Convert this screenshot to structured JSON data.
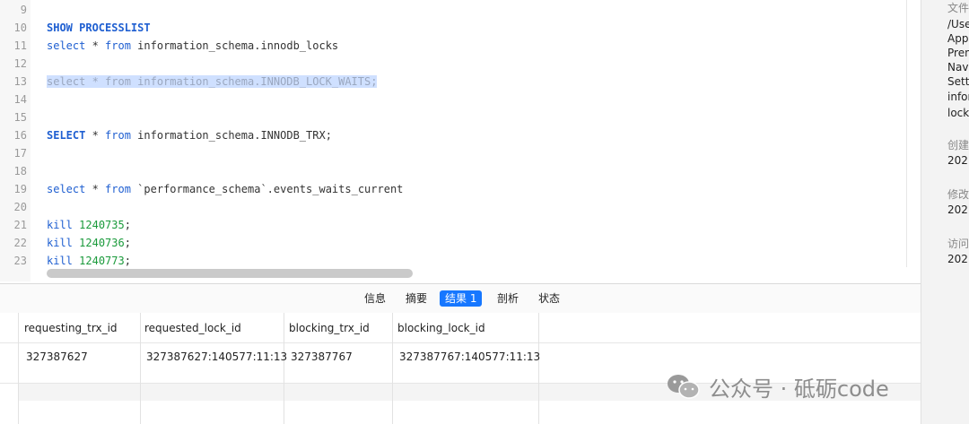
{
  "editor": {
    "lines": [
      {
        "num": "9",
        "parts": []
      },
      {
        "num": "10",
        "parts": [
          {
            "t": "SHOW PROCESSLIST",
            "c": "kw"
          }
        ]
      },
      {
        "num": "11",
        "parts": [
          {
            "t": "select",
            "c": "kw-thin"
          },
          {
            "t": " * ",
            "c": ""
          },
          {
            "t": "from",
            "c": "kw-thin"
          },
          {
            "t": " information_schema.innodb_locks",
            "c": ""
          }
        ]
      },
      {
        "num": "12",
        "parts": []
      },
      {
        "num": "13",
        "parts": [
          {
            "t": "select * from information_schema.INNODB_LOCK_WAITS;",
            "c": "sel"
          }
        ]
      },
      {
        "num": "14",
        "parts": []
      },
      {
        "num": "15",
        "parts": []
      },
      {
        "num": "16",
        "parts": [
          {
            "t": "SELECT",
            "c": "kw"
          },
          {
            "t": " * ",
            "c": ""
          },
          {
            "t": "from",
            "c": "kw-thin"
          },
          {
            "t": " information_schema.INNODB_TRX;",
            "c": ""
          }
        ]
      },
      {
        "num": "17",
        "parts": []
      },
      {
        "num": "18",
        "parts": []
      },
      {
        "num": "19",
        "parts": [
          {
            "t": "select",
            "c": "kw-thin"
          },
          {
            "t": " * ",
            "c": ""
          },
          {
            "t": "from",
            "c": "kw-thin"
          },
          {
            "t": " `performance_schema`.events_waits_current",
            "c": ""
          }
        ]
      },
      {
        "num": "20",
        "parts": []
      },
      {
        "num": "21",
        "parts": [
          {
            "t": "kill",
            "c": "kw-thin"
          },
          {
            "t": " ",
            "c": ""
          },
          {
            "t": "1240735",
            "c": "num"
          },
          {
            "t": ";",
            "c": ""
          }
        ]
      },
      {
        "num": "22",
        "parts": [
          {
            "t": "kill",
            "c": "kw-thin"
          },
          {
            "t": " ",
            "c": ""
          },
          {
            "t": "1240736",
            "c": "num"
          },
          {
            "t": ";",
            "c": ""
          }
        ]
      },
      {
        "num": "23",
        "parts": [
          {
            "t": "kill",
            "c": "kw-thin"
          },
          {
            "t": " ",
            "c": ""
          },
          {
            "t": "1240773",
            "c": "num"
          },
          {
            "t": ";",
            "c": ""
          }
        ]
      }
    ]
  },
  "tabs": {
    "info": "信息",
    "summary": "摘要",
    "result": "结果 1",
    "profile": "剖析",
    "status": "状态"
  },
  "grid": {
    "headers": [
      "requesting_trx_id",
      "requested_lock_id",
      "blocking_trx_id",
      "blocking_lock_id"
    ],
    "rows": [
      [
        "327387627",
        "327387627:140577:11:13",
        "327387767",
        "327387767:140577:11:13"
      ]
    ]
  },
  "side_panel": {
    "file_label": "文件",
    "file_path": [
      "/Use",
      "App",
      "Pren",
      "Nav",
      "Sett",
      "infor",
      "lock"
    ],
    "created_label": "创建",
    "created_value": "202",
    "modified_label": "修改",
    "modified_value": "202",
    "accessed_label": "访问",
    "accessed_value": "202"
  },
  "watermark": {
    "text": "公众号 · 砥砺code"
  }
}
